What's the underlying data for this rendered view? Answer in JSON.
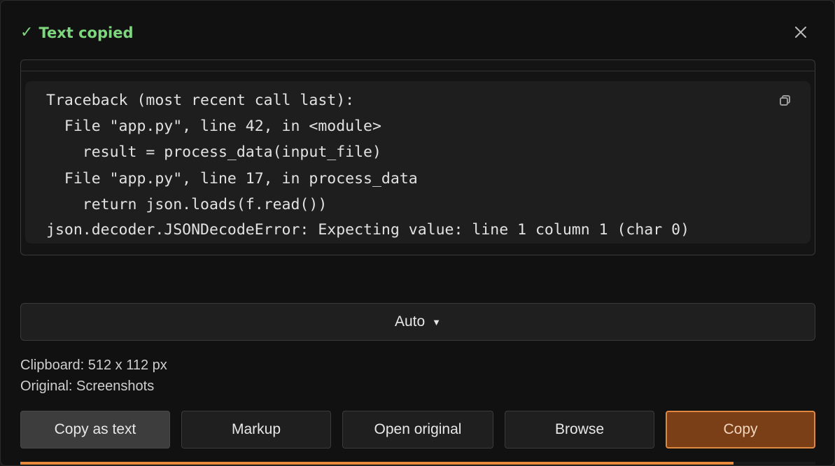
{
  "header": {
    "status_icon": "✓",
    "status_text": "Text copied",
    "status_color": "#7ed67e"
  },
  "close_icon": "close-icon",
  "preview": {
    "lines": [
      "Traceback (most recent call last):",
      "  File \"app.py\", line 42, in <module>",
      "    result = process_data(input_file)",
      "  File \"app.py\", line 17, in process_data",
      "    return json.loads(f.read())",
      "json.decoder.JSONDecodeError: Expecting value: line 1 column 1 (char 0)"
    ],
    "copy_icon": "copy-icon"
  },
  "language_select": {
    "value": "Auto",
    "caret": "▼"
  },
  "info": {
    "clipboard": "Clipboard: 512 x 112 px",
    "original": "Original: Screenshots"
  },
  "buttons": {
    "copy_as_text": "Copy as text",
    "markup": "Markup",
    "open_original": "Open original",
    "browse": "Browse",
    "copy": "Copy"
  },
  "progress": {
    "fraction": 0.897,
    "color": "#e9893c"
  },
  "colors": {
    "accent": "#e08840",
    "primary_button_bg": "#7a3f17"
  }
}
